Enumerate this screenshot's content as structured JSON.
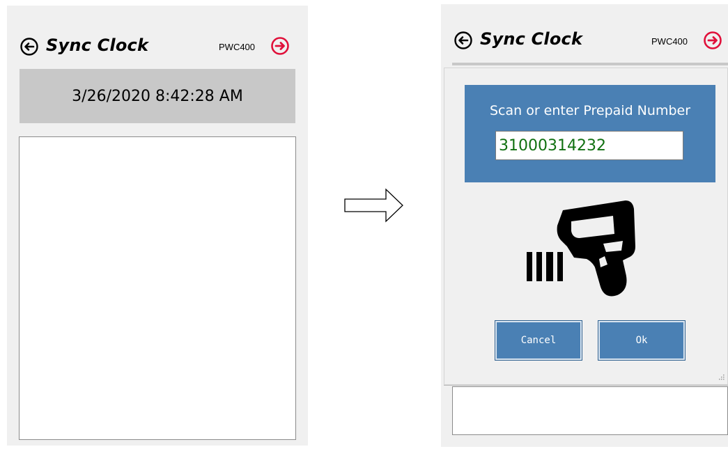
{
  "left_screen": {
    "title": "Sync Clock",
    "device": "PWC400",
    "clock_time": "3/26/2020 8:42:28 AM"
  },
  "right_screen": {
    "title": "Sync Clock",
    "device": "PWC400",
    "dialog": {
      "prompt": "Scan or enter Prepaid Number",
      "prepaid_number": "31000314232",
      "cancel_label": "Cancel",
      "ok_label": "Ok"
    }
  },
  "icons": {
    "back": "back-arrow-circle-icon",
    "next": "forward-arrow-circle-icon",
    "scanner": "barcode-scanner-icon",
    "transition": "right-arrow-outline"
  },
  "colors": {
    "screen_bg": "#f0f0f0",
    "clock_bar": "#c8c8c8",
    "panel_blue": "#4a80b4",
    "next_icon_red": "#e0103a",
    "input_text_green": "#107010"
  }
}
